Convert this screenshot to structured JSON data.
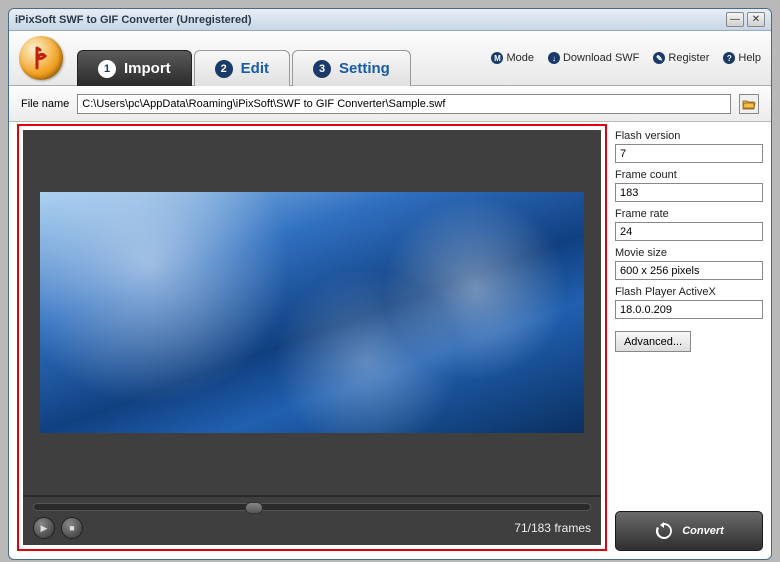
{
  "window": {
    "title": "iPixSoft SWF to GIF Converter (Unregistered)"
  },
  "tabs": [
    {
      "num": "1",
      "label": "Import",
      "active": true
    },
    {
      "num": "2",
      "label": "Edit",
      "active": false
    },
    {
      "num": "3",
      "label": "Setting",
      "active": false
    }
  ],
  "toplinks": {
    "mode": "Mode",
    "download": "Download SWF",
    "register": "Register",
    "help": "Help"
  },
  "file": {
    "label": "File name",
    "path": "C:\\Users\\pc\\AppData\\Roaming\\iPixSoft\\SWF to GIF Converter\\Sample.swf"
  },
  "player": {
    "frames_text": "71/183 frames"
  },
  "info": {
    "flash_version": {
      "label": "Flash version",
      "value": "7"
    },
    "frame_count": {
      "label": "Frame count",
      "value": "183"
    },
    "frame_rate": {
      "label": "Frame rate",
      "value": "24"
    },
    "movie_size": {
      "label": "Movie size",
      "value": "600 x 256 pixels"
    },
    "activex": {
      "label": "Flash Player ActiveX",
      "value": "18.0.0.209"
    }
  },
  "buttons": {
    "advanced": "Advanced...",
    "convert": "Convert"
  }
}
